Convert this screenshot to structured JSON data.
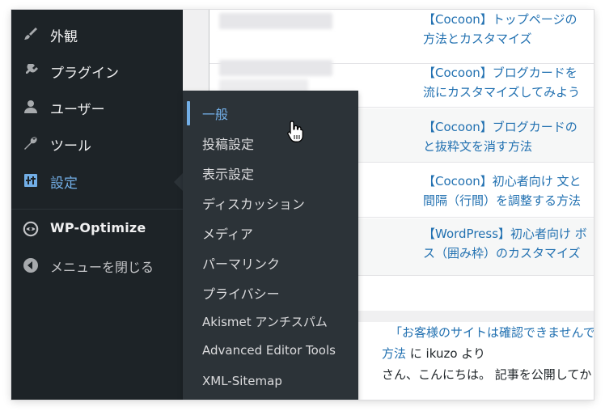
{
  "sidebar": {
    "items": [
      {
        "label": "外観",
        "icon": "paintbrush-icon"
      },
      {
        "label": "プラグイン",
        "icon": "plugin-icon"
      },
      {
        "label": "ユーザー",
        "icon": "user-icon"
      },
      {
        "label": "ツール",
        "icon": "wrench-icon"
      },
      {
        "label": "設定",
        "icon": "settings-icon",
        "active": true
      },
      {
        "label": "WP-Optimize",
        "icon": "wp-optimize-icon"
      },
      {
        "label": "メニューを閉じる",
        "icon": "collapse-arrow-icon"
      }
    ]
  },
  "settings_submenu": {
    "items": [
      {
        "label": "一般",
        "current": true
      },
      {
        "label": "投稿設定"
      },
      {
        "label": "表示設定"
      },
      {
        "label": "ディスカッション"
      },
      {
        "label": "メディア"
      },
      {
        "label": "パーマリンク"
      },
      {
        "label": "プライバシー"
      },
      {
        "label": "Akismet アンチスパム"
      },
      {
        "label": "Advanced Editor Tools"
      },
      {
        "label": "XML-Sitemap"
      }
    ]
  },
  "posts": [
    {
      "line1": "【Cocoon】トップページの",
      "line2": "方法とカスタマイズ"
    },
    {
      "line1": "【Cocoon】ブログカードを",
      "line2": "流にカスタマイズしてみよう"
    },
    {
      "line1": "【Cocoon】ブログカードの",
      "line2": "と抜粋文を消す方法"
    },
    {
      "line1": "【Cocoon】初心者向け 文と",
      "line2": "間隔（行間）を調整する方法"
    },
    {
      "line1": "【WordPress】初心者向け ボ",
      "line2": "ス（囲み枠）のカスタマイズ"
    }
  ],
  "activity": {
    "comment_title": "「お客様のサイトは確認できませんで",
    "comment_link": "方法",
    "comment_by": " に ikuzo より",
    "comment_excerpt": "さん、こんにちは。 記事を公開してか"
  },
  "colors": {
    "sidebar_bg": "#1d2327",
    "submenu_bg": "#2c3338",
    "accent": "#72aee6",
    "link": "#2271b1"
  }
}
